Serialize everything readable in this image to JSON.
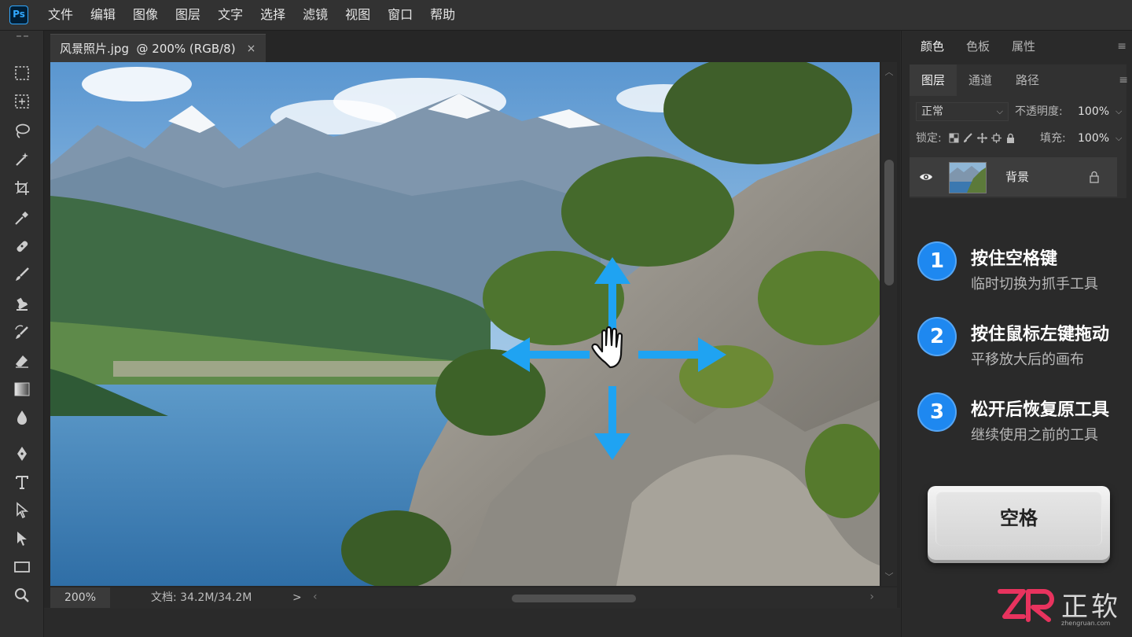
{
  "app": {
    "logo_text": "Ps"
  },
  "menu": [
    "文件",
    "编辑",
    "图像",
    "图层",
    "文字",
    "选择",
    "滤镜",
    "视图",
    "窗口",
    "帮助"
  ],
  "document": {
    "tab_title": "风景照片.jpg  @ 200% (RGB/8)",
    "close_symbol": "×",
    "zoom": "200%",
    "doc_info": "文档: 34.2M/34.2M"
  },
  "tools": [
    "marquee-rect-icon",
    "artboard-icon",
    "lasso-icon",
    "magic-wand-icon",
    "crop-icon",
    "eyedropper-icon",
    "healing-brush-icon",
    "brush-icon",
    "clone-stamp-icon",
    "history-brush-icon",
    "eraser-icon",
    "gradient-icon",
    "blur-icon",
    "dodge-icon",
    "pen-icon",
    "type-icon",
    "path-select-icon",
    "direct-select-icon",
    "rectangle-icon",
    "zoom-icon"
  ],
  "panels": {
    "top_tabs": [
      "颜色",
      "色板",
      "属性"
    ],
    "layers_tabs": [
      "图层",
      "通道",
      "路径"
    ],
    "blend_mode": "正常",
    "opacity_label": "不透明度:",
    "opacity_value": "100%",
    "lock_label": "锁定:",
    "fill_label": "填充:",
    "fill_value": "100%",
    "layer_name": "背景",
    "menu_symbol": "≡"
  },
  "steps": [
    {
      "num": "1",
      "title": "按住空格键",
      "sub": "临时切换为抓手工具"
    },
    {
      "num": "2",
      "title": "按住鼠标左键拖动",
      "sub": "平移放大后的画布"
    },
    {
      "num": "3",
      "title": "松开后恢复原工具",
      "sub": "继续使用之前的工具"
    }
  ],
  "keycap_label": "空格",
  "brand": {
    "logo": "ZR",
    "name": "正软",
    "url": "zhengruan.com"
  },
  "colors": {
    "accent_blue": "#1e88f0",
    "arrow_blue": "#1fa3f2",
    "ps_blue": "#31a8ff",
    "brand_pink": "#e8335e"
  }
}
